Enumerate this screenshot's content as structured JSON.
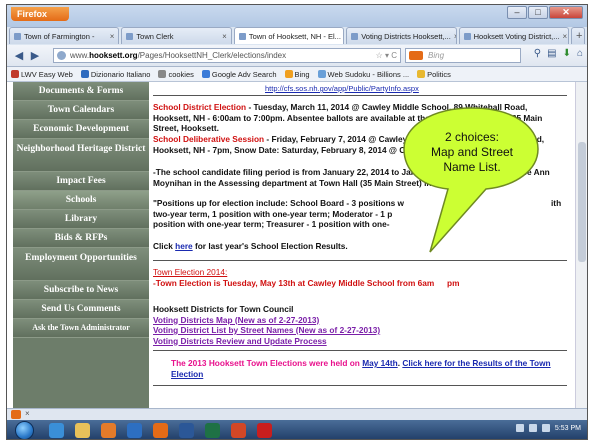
{
  "browser": {
    "app_button": "Firefox",
    "tabs": [
      {
        "label": "Town of Farmington -",
        "active": false
      },
      {
        "label": "Town Clerk",
        "active": false
      },
      {
        "label": "Town of Hooksett, NH - El...",
        "active": true
      },
      {
        "label": "Voting Districts Hooksett,...",
        "active": false
      },
      {
        "label": "Hooksett Voting District,...",
        "active": false
      }
    ],
    "url_prefix": "www.",
    "url_host": "hooksett.org",
    "url_path": "/Pages/HooksettNH_Clerk/elections/index",
    "search_placeholder": "Bing",
    "bookmarks": [
      {
        "label": "LWV Easy Web",
        "color": "#c0392b"
      },
      {
        "label": "Dizionario Italiano",
        "color": "#2e6bbf"
      },
      {
        "label": "cookies",
        "color": "#888888"
      },
      {
        "label": "Google Adv Search",
        "color": "#3b7bd8"
      },
      {
        "label": "Bing",
        "color": "#f0a020"
      },
      {
        "label": "Web Sudoku - Billions ...",
        "color": "#6aa0d8"
      },
      {
        "label": "Politics",
        "color": "#e8b830"
      }
    ]
  },
  "sidebar": {
    "items": [
      {
        "label": "Documents & Forms"
      },
      {
        "label": "Town Calendars"
      },
      {
        "label": "Economic Development"
      },
      {
        "label": "Neighborhood Heritage District"
      },
      {
        "label": "Impact Fees"
      },
      {
        "label": "Schools"
      },
      {
        "label": "Library"
      },
      {
        "label": "Bids & RFPs"
      },
      {
        "label": "Employment Opportunities"
      },
      {
        "label": "Subscribe to News"
      },
      {
        "label": "Send Us Comments"
      },
      {
        "label": "Ask the Town Administrator"
      }
    ]
  },
  "content": {
    "top_link": "http://cfs.sos.nh.gov/app/Public/PartyInfo.aspx",
    "school_election_label": "School District Election",
    "school_election_text": " - Tuesday, March 11, 2014 @ Cawley Middle School, 89 Whitehall Road, Hooksett, NH - 6:00am to 7:00pm.  Absentee ballots are available at the Town Clerk's office, 35 Main Street, Hooksett.",
    "deliberative_label": "School Deliberative Session",
    "deliberative_text": " - Friday, February 7, 2014 @ Cawley Middle School, 89 Whitehall Road, Hooksett, NH - 7pm, Snow Date: Saturday, February 8, 2014 @ Cawley Middle School - 9am",
    "filing_text": "-The school candidate filing period is from January 22, 2014 to January 31, 2014. Please see Lee Ann Moynihan in the Assessing department at Town Hall (35 Main Street) in order to file.",
    "positions_text_1": "\"Positions up for election include: School Board - 3 positions w",
    "positions_text_1b": "ith",
    "positions_text_2": "two-year term, 1 position with one-year term; Moderator - 1 p",
    "positions_text_3": "position with one-year term; Treasurer - 1 position with one-",
    "results_prefix": "Click ",
    "results_link": "here",
    "results_suffix": " for last year's School Election Results.",
    "town_election_title": "Town Election 2014:",
    "town_election_text": "-Town Election is Tuesday, May 13th at Cawley Middle School from 6am",
    "town_election_tail": "pm",
    "districts_heading": "Hooksett Districts for Town Council",
    "district_links": [
      "Voting Districts Map (New as of 2-27-2013)",
      "Voting District List by Street Names (New as of 2-27-2013)",
      "Voting Districts Review and Update Process"
    ],
    "town_2013_text": "The 2013 Hooksett Town Elections were held on ",
    "town_2013_date_link": "May 14th",
    "town_2013_sep": ". ",
    "town_2013_results_link": "Click here for the Results of the Town Election"
  },
  "callout": {
    "line1": "2 choices:",
    "line2": "Map and Street",
    "line3": "Name List.",
    "fill": "#ccff33"
  },
  "taskbar": {
    "icons": [
      {
        "name": "internet-explorer-icon",
        "color": "#3a8fd8"
      },
      {
        "name": "file-explorer-icon",
        "color": "#e7c15a"
      },
      {
        "name": "media-player-icon",
        "color": "#e37b2a"
      },
      {
        "name": "outlook-icon",
        "color": "#2d6fc2"
      },
      {
        "name": "firefox-icon",
        "color": "#e46b17"
      },
      {
        "name": "word-icon",
        "color": "#2b5797"
      },
      {
        "name": "excel-icon",
        "color": "#1e7145"
      },
      {
        "name": "powerpoint-icon",
        "color": "#d24726"
      },
      {
        "name": "acrobat-icon",
        "color": "#c81e1e"
      }
    ],
    "clock": "5:53 PM"
  }
}
